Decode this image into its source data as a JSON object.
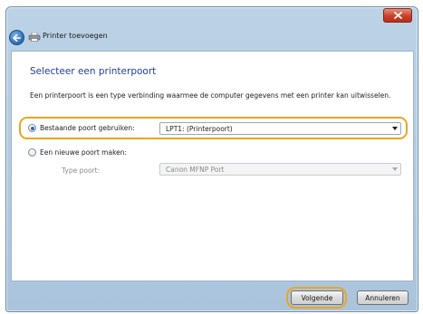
{
  "window": {
    "title": "Printer toevoegen",
    "close_icon": "close-icon",
    "back_icon": "back-arrow-icon",
    "printer_icon": "printer-icon"
  },
  "main": {
    "heading": "Selecteer een printerpoort",
    "description": "Een printerpoort is een type verbinding waarmee de computer gegevens met een printer kan uitwisselen.",
    "existing_port": {
      "label": "Bestaande poort gebruiken:",
      "selected": true,
      "value": "LPT1: (Printerpoort)"
    },
    "new_port": {
      "label": "Een nieuwe poort maken:",
      "selected": false,
      "type_label": "Type poort:",
      "type_value": "Canon MFNP Port"
    }
  },
  "buttons": {
    "next": "Volgende",
    "cancel": "Annuleren"
  },
  "colors": {
    "highlight": "#f0a41e",
    "heading": "#1f3f9e",
    "accent": "#2f6bb8"
  }
}
